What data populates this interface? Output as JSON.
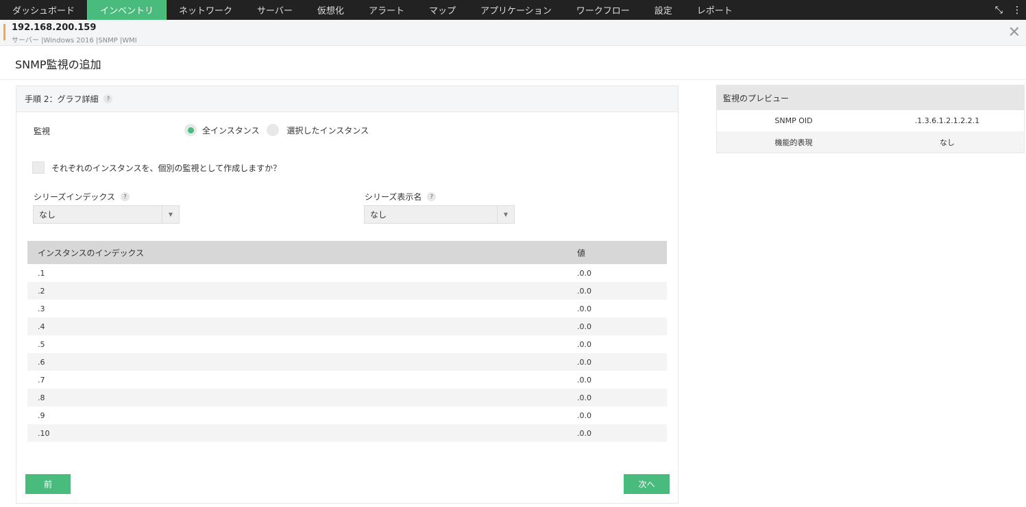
{
  "nav": {
    "items": [
      "ダッシュボード",
      "インベントリ",
      "ネットワーク",
      "サーバー",
      "仮想化",
      "アラート",
      "マップ",
      "アプリケーション",
      "ワークフロー",
      "設定",
      "レポート"
    ],
    "active": 1
  },
  "host": {
    "ip": "192.168.200.159",
    "sub": "サーバー |Windows 2016 |SNMP |WMI"
  },
  "page_title": "SNMP監視の追加",
  "step": {
    "title": "手順 2：グラフ詳細",
    "help": "?"
  },
  "monitor": {
    "label": "監視",
    "opt_all": "全インスタンス",
    "opt_selected": "選択したインスタンス",
    "selected": "all"
  },
  "checkbox_label": "それぞれのインスタンスを、個別の監視として作成しますか？",
  "series_index": {
    "label": "シリーズインデックス",
    "value": "なし"
  },
  "series_name": {
    "label": "シリーズ表示名",
    "value": "なし"
  },
  "table": {
    "headers": [
      "インスタンスのインデックス",
      "値"
    ],
    "rows": [
      [
        ".1",
        ".0.0"
      ],
      [
        ".2",
        ".0.0"
      ],
      [
        ".3",
        ".0.0"
      ],
      [
        ".4",
        ".0.0"
      ],
      [
        ".5",
        ".0.0"
      ],
      [
        ".6",
        ".0.0"
      ],
      [
        ".7",
        ".0.0"
      ],
      [
        ".8",
        ".0.0"
      ],
      [
        ".9",
        ".0.0"
      ],
      [
        ".10",
        ".0.0"
      ]
    ]
  },
  "buttons": {
    "prev": "前",
    "next": "次へ"
  },
  "preview": {
    "title": "監視のプレビュー",
    "rows": [
      [
        "SNMP OID",
        ".1.3.6.1.2.1.2.2.1"
      ],
      [
        "機能的表現",
        "なし"
      ]
    ]
  }
}
